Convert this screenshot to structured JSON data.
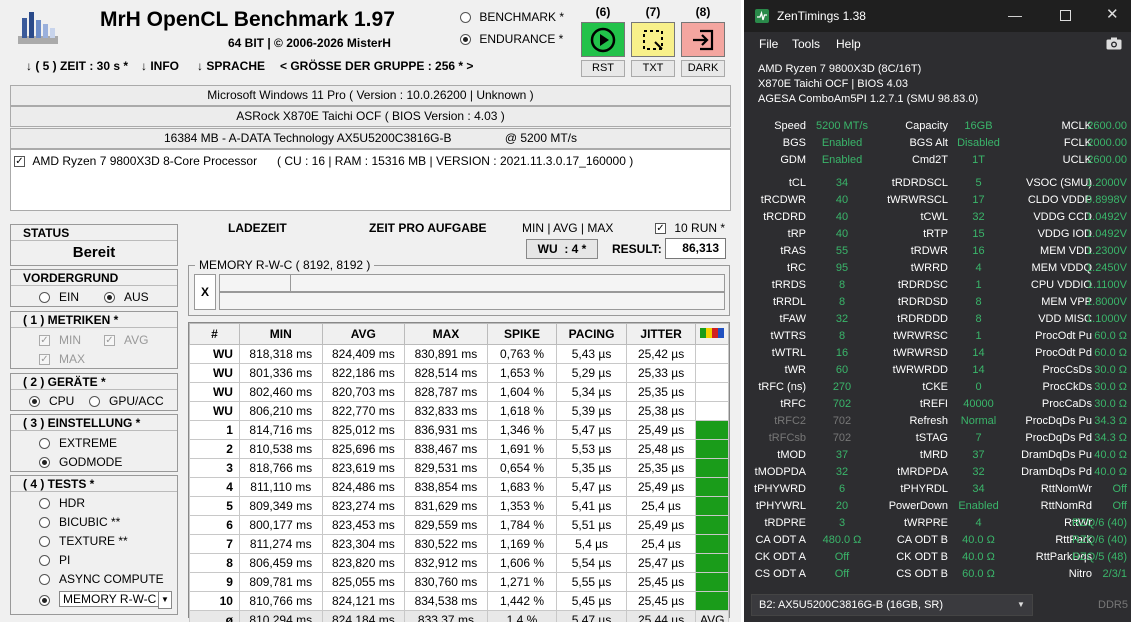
{
  "bench": {
    "title": "MrH OpenCL Benchmark 1.97",
    "subtitle": "64 BIT | ©  2006-2026 MisterH",
    "mode_benchmark": "BENCHMARK *",
    "mode_endurance": "ENDURANCE *",
    "buttons": [
      {
        "num": "(6)",
        "label": "RST",
        "icon": "play-icon",
        "color": "#22c24a"
      },
      {
        "num": "(7)",
        "label": "TXT",
        "icon": "select-icon",
        "color": "#f8f08a"
      },
      {
        "num": "(8)",
        "label": "DARK",
        "icon": "exit-icon",
        "color": "#f4a6a0"
      }
    ],
    "menu": {
      "zeit": "↓ ( 5 ) ZEIT : 30 s *",
      "info": "↓ INFO",
      "sprache": "↓ SPRACHE",
      "gruppe": "< GRÖSSE DER GRUPPE : 256 * >"
    },
    "sysinfo": {
      "os": "Microsoft Windows 11 Pro ( Version : 10.0.26200 | Unknown )",
      "board": "ASRock X870E Taichi OCF ( BIOS Version : 4.03 )",
      "memory": "16384 MB - A-DATA Technology AX5U5200C3816G-B                @ 5200 MT/s",
      "cpu_name": "AMD Ryzen 7 9800X3D 8-Core Processor",
      "cpu_info": "( CU : 16 | RAM : 15316 MB | VERSION : 2021.11.3.0.17_160000 )"
    },
    "status": {
      "head": "STATUS",
      "value": "Bereit"
    },
    "vordergrund": {
      "head": "VORDERGRUND",
      "ein": "EIN",
      "aus": "AUS"
    },
    "metriken": {
      "head": "( 1 ) METRIKEN *",
      "min": "MIN",
      "avg": "AVG",
      "max": "MAX"
    },
    "geraete": {
      "head": "( 2 ) GERÄTE *",
      "cpu": "CPU",
      "gpu": "GPU/ACC"
    },
    "einstellung": {
      "head": "( 3 ) EINSTELLUNG *",
      "extreme": "EXTREME",
      "godmode": "GODMODE"
    },
    "tests": {
      "head": "( 4 ) TESTS *",
      "items": [
        "HDR",
        "BICUBIC **",
        "TEXTURE **",
        "PI",
        "ASYNC COMPUTE"
      ],
      "selected": "MEMORY R-W-C"
    },
    "ladezeit": "LADEZEIT",
    "zeit_pro_aufgabe": "ZEIT PRO AUFGABE",
    "minavgmax": "MIN | AVG | MAX",
    "ten_run": "10 RUN *",
    "wu": "WU  : 4 *",
    "result_label": "RESULT:",
    "result_value": "86,313",
    "memory_box_label": "MEMORY R-W-C ( 8192, 8192 )",
    "x_label": "X",
    "table": {
      "headers": [
        "#",
        "MIN",
        "AVG",
        "MAX",
        "SPIKE",
        "PACING",
        "JITTER"
      ],
      "rows": [
        [
          "WU",
          "818,318 ms",
          "824,409 ms",
          "830,891 ms",
          "0,763 %",
          "5,43 µs",
          "25,42 µs"
        ],
        [
          "WU",
          "801,336 ms",
          "822,186 ms",
          "828,514 ms",
          "1,653 %",
          "5,29 µs",
          "25,33 µs"
        ],
        [
          "WU",
          "802,460 ms",
          "820,703 ms",
          "828,787 ms",
          "1,604 %",
          "5,34 µs",
          "25,35 µs"
        ],
        [
          "WU",
          "806,210 ms",
          "822,770 ms",
          "832,833 ms",
          "1,618 %",
          "5,39 µs",
          "25,38 µs"
        ],
        [
          "1",
          "814,716 ms",
          "825,012 ms",
          "836,931 ms",
          "1,346 %",
          "5,47 µs",
          "25,49 µs"
        ],
        [
          "2",
          "810,538 ms",
          "825,696 ms",
          "838,467 ms",
          "1,691 %",
          "5,53 µs",
          "25,48 µs"
        ],
        [
          "3",
          "818,766 ms",
          "823,619 ms",
          "829,531 ms",
          "0,654 %",
          "5,35 µs",
          "25,35 µs"
        ],
        [
          "4",
          "811,110 ms",
          "824,486 ms",
          "838,854 ms",
          "1,683 %",
          "5,47 µs",
          "25,49 µs"
        ],
        [
          "5",
          "809,349 ms",
          "823,274 ms",
          "831,629 ms",
          "1,353 %",
          "5,41 µs",
          "25,4 µs"
        ],
        [
          "6",
          "800,177 ms",
          "823,453 ms",
          "829,559 ms",
          "1,784 %",
          "5,51 µs",
          "25,49 µs"
        ],
        [
          "7",
          "811,274 ms",
          "823,304 ms",
          "830,522 ms",
          "1,169 %",
          "5,4 µs",
          "25,4 µs"
        ],
        [
          "8",
          "806,459 ms",
          "823,820 ms",
          "832,912 ms",
          "1,606 %",
          "5,54 µs",
          "25,47 µs"
        ],
        [
          "9",
          "809,781 ms",
          "825,055 ms",
          "830,760 ms",
          "1,271 %",
          "5,55 µs",
          "25,45 µs"
        ],
        [
          "10",
          "810,766 ms",
          "824,121 ms",
          "834,538 ms",
          "1,442 %",
          "5,45 µs",
          "25,45 µs"
        ]
      ],
      "avg_row": [
        "ø",
        "810,294 ms",
        "824,184 ms",
        "833,37 ms",
        "1,4 %",
        "5,47 µs",
        "25,44 µs"
      ],
      "avg_flag": "AVG",
      "status_colors": [
        "",
        "",
        "",
        "",
        "#1a9c1a",
        "#1a9c1a",
        "#1a9c1a",
        "#1a9c1a",
        "#1a9c1a",
        "#1a9c1a",
        "#1a9c1a",
        "#1a9c1a",
        "#1a9c1a",
        "#1a9c1a"
      ]
    }
  },
  "zen": {
    "title": "ZenTimings 1.38",
    "menu": [
      "File",
      "Tools",
      "Help"
    ],
    "sys": [
      "AMD Ryzen 7 9800X3D (8C/16T)",
      "X870E Taichi OCF | BIOS 4.03",
      "AGESA ComboAm5PI 1.2.7.1 (SMU 98.83.0)"
    ],
    "rows": [
      [
        [
          "Speed",
          "5200 MT/s"
        ],
        [
          "Capacity",
          "16GB"
        ],
        [
          "MCLK",
          "2600.00"
        ]
      ],
      [
        [
          "BGS",
          "Enabled"
        ],
        [
          "BGS Alt",
          "Disabled"
        ],
        [
          "FCLK",
          "2000.00"
        ]
      ],
      [
        [
          "GDM",
          "Enabled"
        ],
        [
          "Cmd2T",
          "1T"
        ],
        [
          "UCLK",
          "2600.00"
        ]
      ],
      null,
      [
        [
          "tCL",
          "34"
        ],
        [
          "tRDRDSCL",
          "5"
        ],
        [
          "VSOC (SMU)",
          "1.2000V"
        ]
      ],
      [
        [
          "tRCDWR",
          "40"
        ],
        [
          "tWRWRSCL",
          "17"
        ],
        [
          "CLDO VDDP",
          "0.8998V"
        ]
      ],
      [
        [
          "tRCDRD",
          "40"
        ],
        [
          "tCWL",
          "32"
        ],
        [
          "VDDG CCD",
          "1.0492V"
        ]
      ],
      [
        [
          "tRP",
          "40"
        ],
        [
          "tRTP",
          "15"
        ],
        [
          "VDDG IOD",
          "1.0492V"
        ]
      ],
      [
        [
          "tRAS",
          "55"
        ],
        [
          "tRDWR",
          "16"
        ],
        [
          "MEM VDD",
          "1.2300V"
        ]
      ],
      [
        [
          "tRC",
          "95"
        ],
        [
          "tWRRD",
          "4"
        ],
        [
          "MEM VDDQ",
          "1.2450V"
        ]
      ],
      [
        [
          "tRRDS",
          "8"
        ],
        [
          "tRDRDSC",
          "1"
        ],
        [
          "CPU VDDIO",
          "1.1100V"
        ]
      ],
      [
        [
          "tRRDL",
          "8"
        ],
        [
          "tRDRDSD",
          "8"
        ],
        [
          "MEM VPP",
          "1.8000V"
        ]
      ],
      [
        [
          "tFAW",
          "32"
        ],
        [
          "tRDRDDD",
          "8"
        ],
        [
          "VDD MISC",
          "1.1000V"
        ]
      ],
      [
        [
          "tWTRS",
          "8"
        ],
        [
          "tWRWRSC",
          "1"
        ],
        [
          "ProcOdt Pu",
          "60.0 Ω"
        ]
      ],
      [
        [
          "tWTRL",
          "16"
        ],
        [
          "tWRWRSD",
          "14"
        ],
        [
          "ProcOdt Pd",
          "60.0 Ω"
        ]
      ],
      [
        [
          "tWR",
          "60"
        ],
        [
          "tWRWRDD",
          "14"
        ],
        [
          "ProcCsDs",
          "30.0 Ω"
        ]
      ],
      [
        [
          "tRFC (ns)",
          "270"
        ],
        [
          "tCKE",
          "0"
        ],
        [
          "ProcCkDs",
          "30.0 Ω"
        ]
      ],
      [
        [
          "tRFC",
          "702"
        ],
        [
          "tREFI",
          "40000"
        ],
        [
          "ProcCaDs",
          "30.0 Ω"
        ]
      ],
      [
        [
          "tRFC2",
          "702"
        ],
        [
          "Refresh",
          "Normal"
        ],
        [
          "ProcDqDs Pu",
          "34.3 Ω"
        ]
      ],
      [
        [
          "tRFCsb",
          "702"
        ],
        [
          "tSTAG",
          "7"
        ],
        [
          "ProcDqDs Pd",
          "34.3 Ω"
        ]
      ],
      [
        [
          "tMOD",
          "37"
        ],
        [
          "tMRD",
          "37"
        ],
        [
          "DramDqDs Pu",
          "40.0 Ω"
        ]
      ],
      [
        [
          "tMODPDA",
          "32"
        ],
        [
          "tMRDPDA",
          "32"
        ],
        [
          "DramDqDs Pd",
          "40.0 Ω"
        ]
      ],
      [
        [
          "tPHYWRD",
          "6"
        ],
        [
          "tPHYRDL",
          "34"
        ],
        [
          "RttNomWr",
          "Off"
        ]
      ],
      [
        [
          "tPHYWRL",
          "20"
        ],
        [
          "PowerDown",
          "Enabled"
        ],
        [
          "RttNomRd",
          "Off"
        ]
      ],
      [
        [
          "tRDPRE",
          "3"
        ],
        [
          "tWRPRE",
          "4"
        ],
        [
          "RttWr",
          "RZQ/6 (40)"
        ]
      ],
      [
        [
          "CA ODT A",
          "480.0 Ω"
        ],
        [
          "CA ODT B",
          "40.0 Ω"
        ],
        [
          "RttPark",
          "RZQ/6 (40)"
        ]
      ],
      [
        [
          "CK ODT A",
          "Off"
        ],
        [
          "CK ODT B",
          "40.0 Ω"
        ],
        [
          "RttParkDqs",
          "RZQ/5 (48)"
        ]
      ],
      [
        [
          "CS ODT A",
          "Off"
        ],
        [
          "CS ODT B",
          "60.0 Ω"
        ],
        [
          "Nitro",
          "2/3/1"
        ]
      ]
    ],
    "dimm_select": "B2: AX5U5200C3816G-B (16GB, SR)",
    "ddr": "DDR5",
    "accent": "#3ab56a"
  }
}
